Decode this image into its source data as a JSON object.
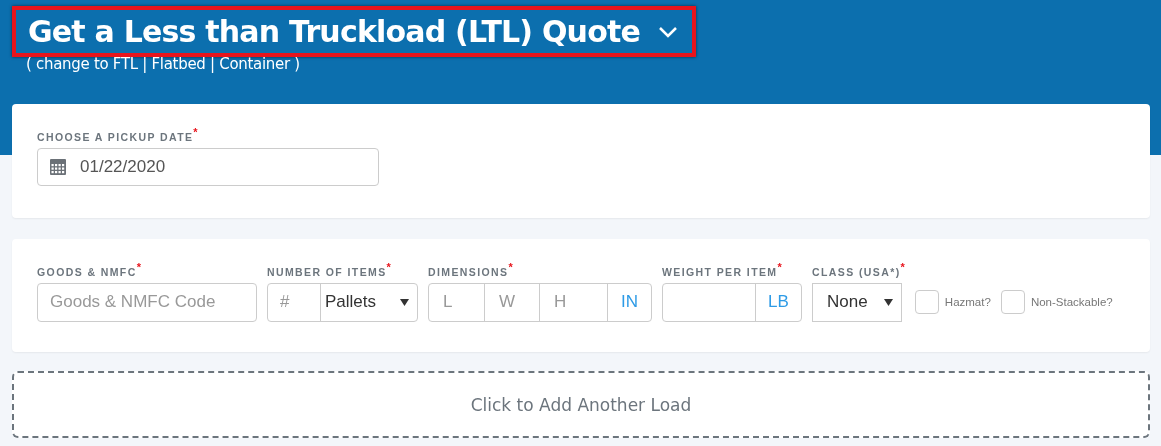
{
  "header": {
    "title": "Get a Less than Truckload (LTL) Quote",
    "highlighted": true,
    "subtitle": "( change to FTL | Flatbed | Container )"
  },
  "pickup": {
    "label": "CHOOSE A PICKUP DATE$^{*}$",
    "value": "01/22/2020"
  },
  "load_fields": [
    {
      "kind": "text",
      "label": "GOODS & NMFC$^{*}$",
      "placeholder": "Goods & NMFC Code"
    },
    {
      "kind": "count",
      "label": "NUMBER OF ITEMS$^{*}$",
      "placeholder": "#",
      "unit": "Pallets"
    },
    {
      "kind": "dimensions",
      "label": "DIMENSIONS$^{*}$",
      "parts": [
        "L",
        "W",
        "H"
      ],
      "unit": "IN"
    },
    {
      "kind": "unit",
      "label": "WEIGHT PER ITEM$^{*}$",
      "unit": "LB"
    },
    {
      "kind": "select",
      "label": "CLASS (USA*)$^{*}$",
      "value": "None"
    },
    {
      "kind": "checkbox",
      "label": "Hazmat?",
      "checked": false
    },
    {
      "kind": "checkbox",
      "label": "Non-Stackable?",
      "checked": false
    }
  ],
  "add_button": "Click to Add Another Load"
}
